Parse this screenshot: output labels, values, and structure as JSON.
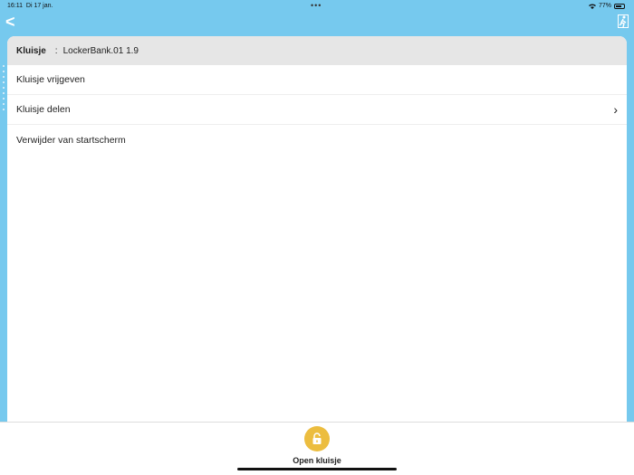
{
  "status": {
    "time": "16:11",
    "date": "Di 17 jan.",
    "battery": "77%",
    "battery_level": 77
  },
  "header": {
    "back": "<"
  },
  "card": {
    "label": "Kluisje",
    "separator": ":",
    "value": "LockerBank.01 1.9",
    "items": [
      {
        "label": "Kluisje vrijgeven"
      },
      {
        "label": "Kluisje delen",
        "chevron": "›"
      },
      {
        "label": "Verwijder van startscherm"
      }
    ]
  },
  "footer": {
    "open_label": "Open kluisje"
  },
  "colors": {
    "accent": "#76c9ee",
    "lock": "#ecbd3f"
  }
}
